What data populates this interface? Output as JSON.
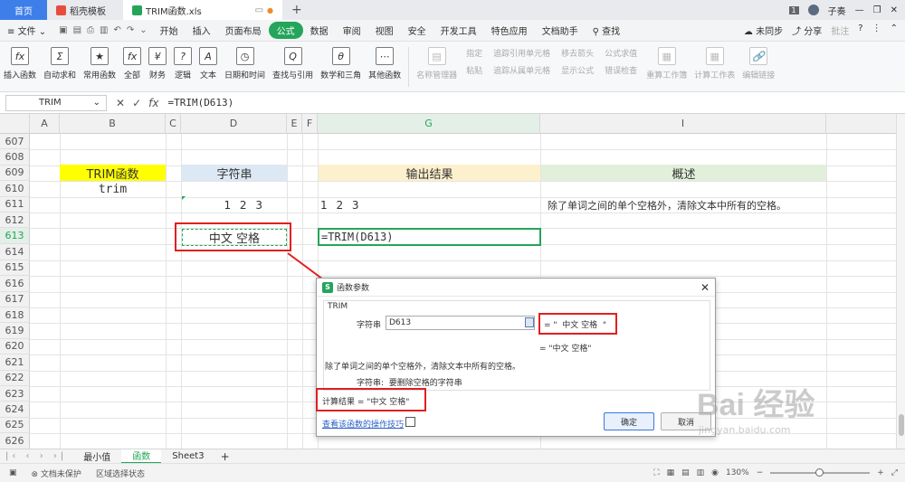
{
  "titlebar": {
    "home_tab": "首页",
    "doc_tab": "稻壳模板",
    "active_tab": "TRIM函数.xls",
    "page_count": "1",
    "user": "子奏"
  },
  "menubar": {
    "file": "文件",
    "items": [
      "开始",
      "插入",
      "页面布局",
      "公式",
      "数据",
      "审阅",
      "视图",
      "安全",
      "开发工具",
      "特色应用",
      "文档助手"
    ],
    "active": "公式",
    "search": "查找",
    "sync": "未同步",
    "share": "分享",
    "comment": "批注"
  },
  "ribbon": {
    "buttons": [
      {
        "label": "插入函数",
        "icon": "fx"
      },
      {
        "label": "自动求和",
        "icon": "Σ"
      },
      {
        "label": "常用函数",
        "icon": "★"
      },
      {
        "label": "全部",
        "icon": "fx"
      },
      {
        "label": "财务",
        "icon": "¥"
      },
      {
        "label": "逻辑",
        "icon": "?"
      },
      {
        "label": "文本",
        "icon": "A"
      },
      {
        "label": "日期和时间",
        "icon": "◷"
      },
      {
        "label": "查找与引用",
        "icon": "Q"
      },
      {
        "label": "数学和三角",
        "icon": "θ"
      },
      {
        "label": "其他函数",
        "icon": "⋯"
      }
    ],
    "disabled_buttons": [
      {
        "label": "名称管理器",
        "icon": "▤"
      }
    ],
    "small_col1": [
      "指定",
      "粘贴"
    ],
    "small_col2": [
      "追踪引用单元格",
      "追踪从属单元格"
    ],
    "small_col3": [
      "移去箭头",
      "显示公式"
    ],
    "small_col4": [
      "公式求值",
      "错误检查"
    ],
    "right_buttons": [
      {
        "label": "重算工作簿",
        "icon": "▦"
      },
      {
        "label": "计算工作表",
        "icon": "▦"
      },
      {
        "label": "编辑链接",
        "icon": "🔗"
      }
    ]
  },
  "formulabar": {
    "name_box": "TRIM",
    "formula": "=TRIM(D613)"
  },
  "columns": [
    "A",
    "B",
    "C",
    "D",
    "E",
    "F",
    "G",
    "I"
  ],
  "selected_column": "G",
  "rows": [
    "607",
    "608",
    "609",
    "610",
    "611",
    "612",
    "613",
    "614",
    "615",
    "616",
    "617",
    "618",
    "619",
    "620",
    "621",
    "622",
    "623",
    "624",
    "625",
    "626"
  ],
  "selected_row": "613",
  "cells": {
    "b609": "TRIM函数",
    "b610": "trim",
    "d609": "字符串",
    "d611": "1 2 3",
    "d613": "中文 空格",
    "g609": "输出结果",
    "g611": "1 2 3",
    "g613": "=TRIM(D613)",
    "i609": "概述",
    "i611": "除了单词之间的单个空格外，清除文本中所有的空格。"
  },
  "colors": {
    "trim_header": "#ffff00",
    "string_header": "#dde8f5",
    "output_header": "#fdf0cc",
    "summary_header": "#e2efda",
    "accent": "#24a55a",
    "highlight": "#e02020"
  },
  "dialog": {
    "title": "函数参数",
    "function_name": "TRIM",
    "arg_label": "字符串",
    "arg_value": "D613",
    "arg_result": "= \"  中文 空格  \"",
    "result_line": "= \"中文 空格\"",
    "description": "除了单词之间的单个空格外，清除文本中所有的空格。",
    "arg_desc_label": "字符串:",
    "arg_desc": "要删除空格的字符串",
    "calc_result": "计算结果 = \"中文 空格\"",
    "help_link": "查看该函数的操作技巧",
    "ok": "确定",
    "cancel": "取消"
  },
  "sheet_tabs": [
    "最小值",
    "函数",
    "Sheet3"
  ],
  "active_sheet": "函数",
  "statusbar": {
    "protect": "文档未保护",
    "select_status": "区域选择状态",
    "zoom": "130%"
  },
  "watermark": {
    "text": "Bai 经验",
    "url": "jingyan.baidu.com"
  }
}
